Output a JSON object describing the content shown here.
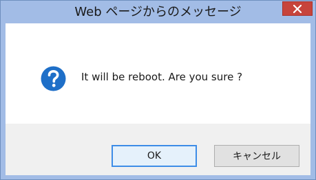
{
  "window": {
    "title": "Web ページからのメッセージ",
    "close_icon": "close-icon"
  },
  "dialog": {
    "icon": "question-icon",
    "message": "It will be reboot. Are you sure ?"
  },
  "buttons": {
    "ok_label": "OK",
    "cancel_label": "キャンセル"
  },
  "colors": {
    "frame": "#a2bce6",
    "close_button": "#c7443b",
    "icon_blue": "#1e6fc8",
    "focus_border": "#3c8ce7"
  }
}
